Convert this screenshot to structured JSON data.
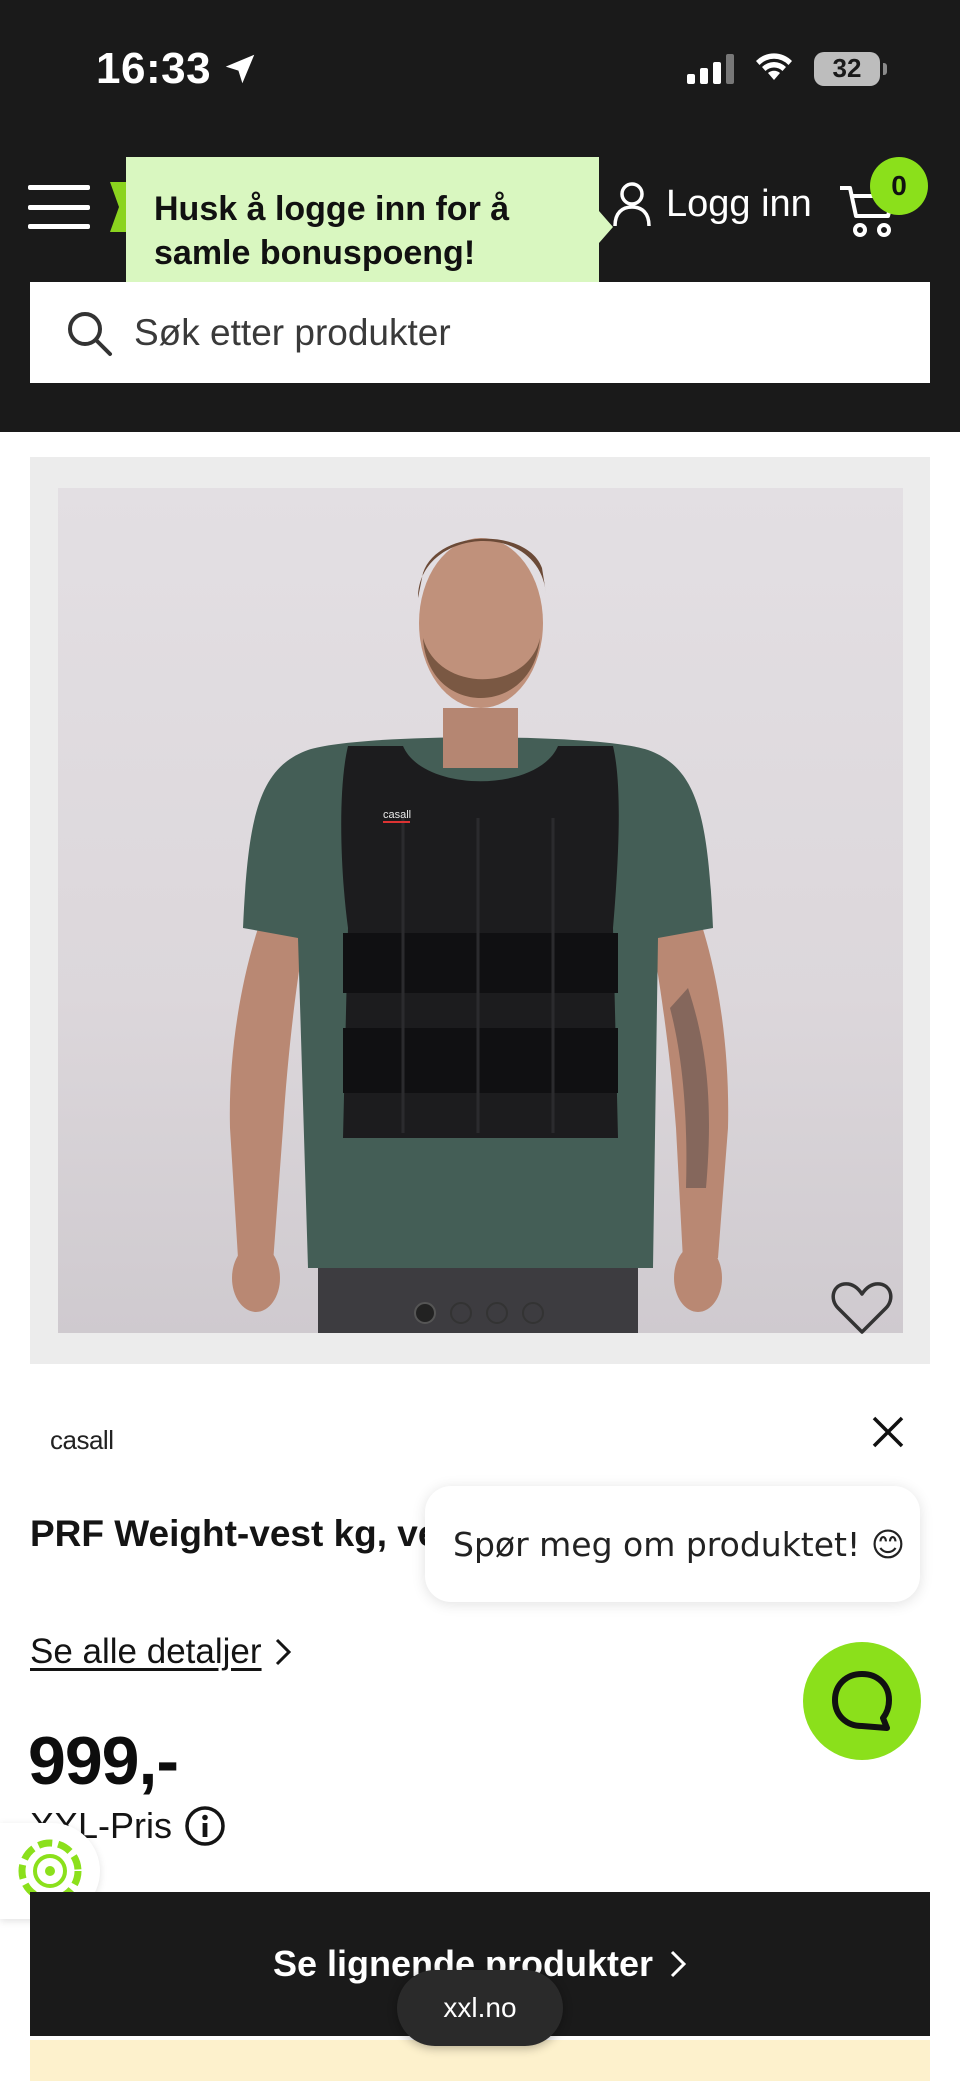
{
  "status_bar": {
    "time": "16:33",
    "battery": "32",
    "icons": [
      "location-arrow-icon",
      "signal-icon",
      "wifi-icon",
      "battery-icon"
    ]
  },
  "header": {
    "login_label": "Logg inn",
    "cart_count": "0",
    "tooltip_text": "Husk å logge inn for å samle bonuspoeng!",
    "accent_color": "#8be01b",
    "icons": [
      "menu-icon",
      "user-icon",
      "cart-icon"
    ]
  },
  "search": {
    "placeholder": "Søk etter produkter",
    "icon": "search-icon"
  },
  "gallery": {
    "image_count": 4,
    "active_index": 0,
    "vest_label": "casall"
  },
  "product": {
    "brand": "casall",
    "title": "PRF Weight-vest kg, vekt",
    "see_details_label": "Se alle detaljer",
    "price": "999,-",
    "price_label": "XXL-Pris"
  },
  "chat": {
    "bubble_text": "Spør meg om produktet! 😊",
    "icon": "chat-icon"
  },
  "cta": {
    "similar_label": "Se lignende produkter"
  },
  "browser": {
    "url": "xxl.no"
  }
}
